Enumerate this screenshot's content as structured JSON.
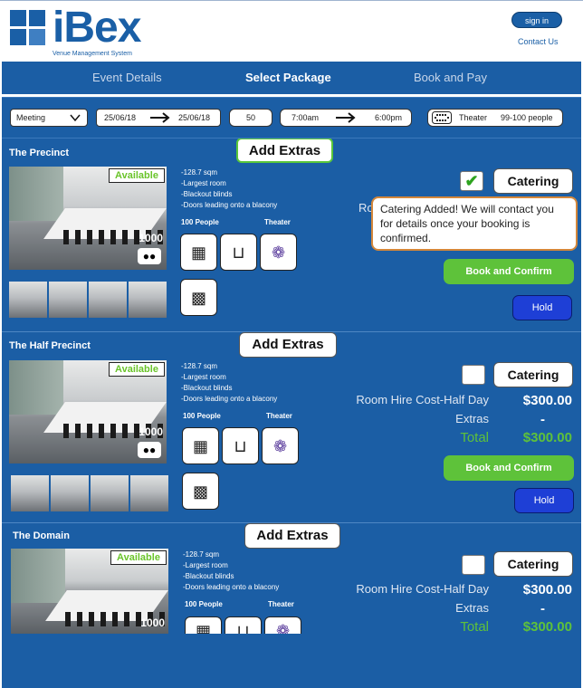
{
  "brand": {
    "name": "iBex",
    "tagline": "Venue Management System",
    "color": "#1a5fa6"
  },
  "header": {
    "sign_in": "sign in",
    "contact": "Contact Us"
  },
  "nav": {
    "steps": [
      "Event Details",
      "Select Package",
      "Book and Pay"
    ],
    "active": "Select Package"
  },
  "filters": {
    "event_type": "Meeting",
    "date_from": "25/06/18",
    "date_to": "25/06/18",
    "guests": "50",
    "time_from": "7:00am",
    "time_to": "6:00pm",
    "layout": "Theater",
    "layout_range": "99-100 people"
  },
  "venues": [
    {
      "name": "The Precinct",
      "extras_label": "Add Extras",
      "status": "Available",
      "capacity": "1000",
      "description": [
        "-128.7 sqm",
        "-Largest room",
        "-Blackout blinds",
        "-Doors leading onto a blacony"
      ],
      "people_label": "100 People",
      "layout_label": "Theater",
      "catering_label": "Catering",
      "catering_checked": true,
      "tooltip": "Catering Added! We will contact you for details once your booking is confirmed.",
      "room_hire_partial": "Ro",
      "book_label": "Book and Confirm",
      "hold_label": "Hold"
    },
    {
      "name": "The Half Precinct",
      "extras_label": "Add Extras",
      "status": "Available",
      "capacity": "1000",
      "description": [
        "-128.7 sqm",
        "-Largest room",
        "-Blackout blinds",
        "-Doors leading onto a blacony"
      ],
      "people_label": "100 People",
      "layout_label": "Theater",
      "catering_label": "Catering",
      "catering_checked": false,
      "room_hire_label": "Room Hire Cost-Half Day",
      "room_hire_value": "$300.00",
      "extras_row_label": "Extras",
      "extras_value": "-",
      "total_label": "Total",
      "total_value": "$300.00",
      "book_label": "Book and Confirm",
      "hold_label": "Hold"
    },
    {
      "name": "The Domain",
      "extras_label": "Add Extras",
      "status": "Available",
      "capacity": "1000",
      "description": [
        "-128.7 sqm",
        "-Largest room",
        "-Blackout blinds",
        "-Doors leading onto a blacony"
      ],
      "people_label": "100 People",
      "layout_label": "Theater",
      "catering_label": "Catering",
      "catering_checked": false,
      "room_hire_label": "Room Hire Cost-Half Day",
      "room_hire_value": "$300.00",
      "extras_row_label": "Extras",
      "extras_value": "-",
      "total_label": "Total",
      "total_value": "$300.00"
    }
  ],
  "colors": {
    "panel": "#1b5ea5",
    "available": "#6ac42a",
    "book": "#5ec23a",
    "hold": "#1e3fd6",
    "tooltip_border": "#d4873a"
  }
}
